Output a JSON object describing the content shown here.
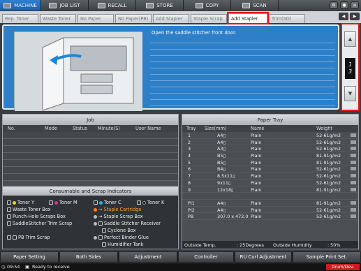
{
  "modes": [
    {
      "label": "MACHINE",
      "icon": "machine-icon"
    },
    {
      "label": "JOB LIST",
      "icon": "job-list-icon"
    },
    {
      "label": "RECALL",
      "icon": "recall-icon"
    },
    {
      "label": "STORE",
      "icon": "store-icon"
    },
    {
      "label": "COPY",
      "icon": "copy-icon"
    },
    {
      "label": "SCAN",
      "icon": "scan-icon"
    }
  ],
  "tabs": [
    "Rep. Toner",
    "Waste Toner",
    "No Paper",
    "No Paper(PB)",
    "Add Stapler",
    "Staple Scrap",
    "Add Stapler",
    "Trim(SD)"
  ],
  "message": "Open the saddle stitcher front door.",
  "page": {
    "current": "1",
    "total": "3"
  },
  "job": {
    "title": "Job",
    "columns": [
      "No.",
      "Mode",
      "Status",
      "Minute(S)",
      "User Name"
    ]
  },
  "consumables": {
    "title": "Consumable and Scrap Indicators",
    "items": [
      {
        "label": "Toner Y",
        "color": "#f2d21b"
      },
      {
        "label": "Toner M",
        "color": "#d62ea0"
      },
      {
        "label": "Toner C",
        "color": "#25b4e6"
      },
      {
        "label": "Toner K",
        "color": "#111111"
      },
      {
        "label": "Waste Toner Box"
      },
      {
        "label": "Staple Cartridge",
        "warn": true
      },
      {
        "label": "Punch-Hole Scraps Box"
      },
      {
        "label": "Staple Scrap Box"
      },
      {
        "label": "SaddleStitcher Trim Scrap"
      },
      {
        "label": "Saddle Stitcher Receiver"
      },
      {
        "label": "Cyclone Box"
      },
      {
        "label": "PB Trim Scrap"
      },
      {
        "label": "Perfect Binder Glue"
      },
      {
        "label": "Humidifier Tank"
      }
    ]
  },
  "tray": {
    "title": "Paper Tray",
    "columns": [
      "Tray",
      "Size(mm)",
      "Name",
      "Weight"
    ],
    "rows": [
      {
        "tray": "1",
        "size": "A4▯",
        "name": "Plain",
        "weight": "52-61g/m2"
      },
      {
        "tray": "2",
        "size": "A4▯",
        "name": "Plain",
        "weight": "52-61g/m2"
      },
      {
        "tray": "3",
        "size": "A3▯",
        "name": "Plain",
        "weight": "52-61g/m2"
      },
      {
        "tray": "4",
        "size": "B5▯",
        "name": "Plain",
        "weight": "81-91g/m2"
      },
      {
        "tray": "5",
        "size": "B5▯",
        "name": "Plain",
        "weight": "81-91g/m2"
      },
      {
        "tray": "6",
        "size": "B4▯",
        "name": "Plain",
        "weight": "52-61g/m2"
      },
      {
        "tray": "7",
        "size": "8.5x11▯",
        "name": "Plain",
        "weight": "52-61g/m2"
      },
      {
        "tray": "8",
        "size": "9x11▯",
        "name": "Plain",
        "weight": "52-61g/m2"
      },
      {
        "tray": "9",
        "size": "12x18▯",
        "name": "Plain",
        "weight": "81-91g/m2"
      },
      {
        "tray": "",
        "size": "",
        "name": "",
        "weight": ""
      },
      {
        "tray": "PI1",
        "size": "A4▯",
        "name": "Plain",
        "weight": "81-91g/m2"
      },
      {
        "tray": "PI2",
        "size": "A4▯",
        "name": "Plain",
        "weight": "52-61g/m2"
      },
      {
        "tray": "PB",
        "size": "307.0 x 472.0",
        "name": "Plain",
        "weight": "52-61g/m2"
      }
    ],
    "outside_temp_label": "Outside Temp.",
    "outside_temp": ": 25Degrees",
    "outside_humidity_label": "Outside Humidity",
    "outside_humidity": ": 50%"
  },
  "funcbar": [
    "Paper Setting",
    "Both Sides",
    "Adjustment",
    "Controller",
    "RU Curl Adjustment",
    "Sample Print Set."
  ],
  "status": {
    "time": "09:54",
    "text": "Ready to receive",
    "badge": "Drum/Dev."
  }
}
